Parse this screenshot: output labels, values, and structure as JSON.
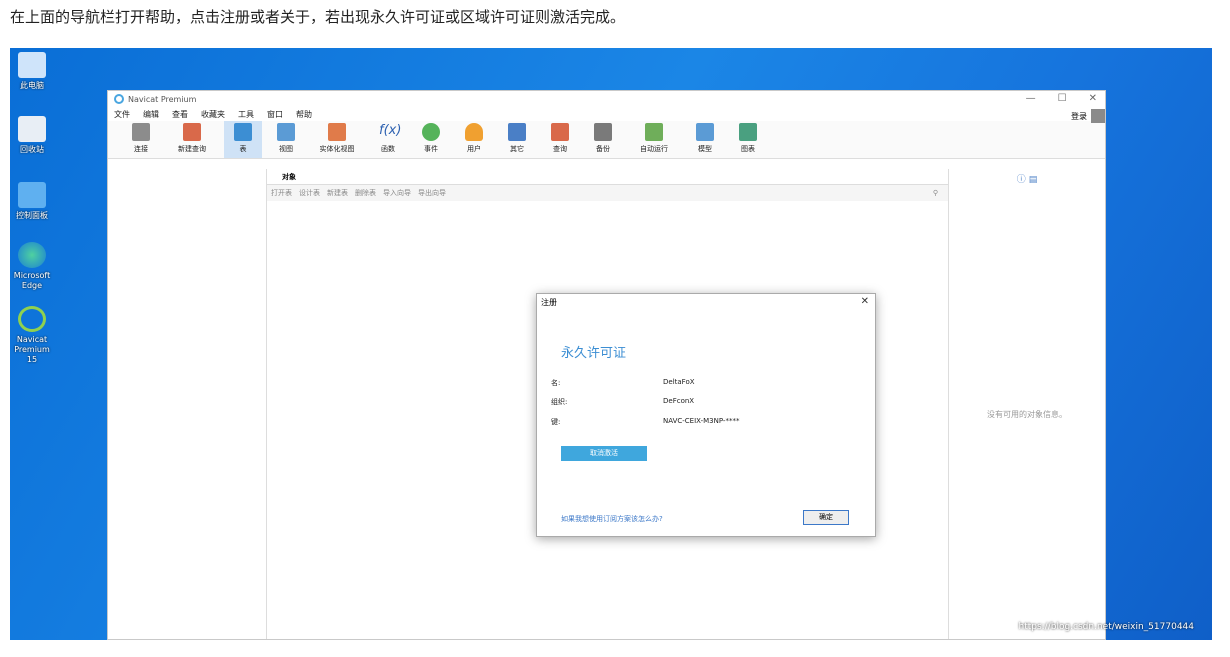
{
  "caption": "在上面的导航栏打开帮助，点击注册或者关于，若出现永久许可证或区域许可证则激活完成。",
  "desktop_icons": [
    {
      "label": "此电脑",
      "icon": "computer-icon"
    },
    {
      "label": "回收站",
      "icon": "recycle-bin-icon"
    },
    {
      "label": "控制面板",
      "icon": "control-panel-icon"
    },
    {
      "label": "Microsoft Edge",
      "icon": "edge-icon"
    },
    {
      "label": "Navicat Premium 15",
      "icon": "navicat-icon"
    }
  ],
  "window": {
    "title": "Navicat Premium",
    "controls": {
      "minimize": "—",
      "maximize": "☐",
      "close": "✕"
    },
    "login": "登录"
  },
  "menu": [
    "文件",
    "编辑",
    "查看",
    "收藏夹",
    "工具",
    "窗口",
    "帮助"
  ],
  "toolbar": [
    {
      "label": "连接",
      "icon": "connection-icon"
    },
    {
      "label": "新建查询",
      "icon": "new-query-icon"
    },
    {
      "label": "表",
      "icon": "table-icon",
      "active": true
    },
    {
      "label": "视图",
      "icon": "view-icon"
    },
    {
      "label": "实体化视图",
      "icon": "materialized-view-icon"
    },
    {
      "label": "函数",
      "icon": "function-icon"
    },
    {
      "label": "事件",
      "icon": "event-icon"
    },
    {
      "label": "用户",
      "icon": "user-icon"
    },
    {
      "label": "其它",
      "icon": "others-icon"
    },
    {
      "label": "查询",
      "icon": "query-icon"
    },
    {
      "label": "备份",
      "icon": "backup-icon"
    },
    {
      "label": "自动运行",
      "icon": "automation-icon"
    },
    {
      "label": "模型",
      "icon": "model-icon"
    },
    {
      "label": "图表",
      "icon": "chart-icon"
    }
  ],
  "object_tab": "对象",
  "object_actions": [
    "打开表",
    "设计表",
    "新建表",
    "删除表",
    "导入向导",
    "导出向导"
  ],
  "right_pane": {
    "empty_text": "没有可用的对象信息。"
  },
  "dialog": {
    "title": "注册",
    "close": "✕",
    "heading": "永久许可证",
    "rows": [
      {
        "label": "名:",
        "value": "DeltaFoX"
      },
      {
        "label": "组织:",
        "value": "DeFconX"
      },
      {
        "label": "键:",
        "value": "NAVC-CEIX-M3NP-****"
      }
    ],
    "deactivate": "取消激活",
    "help_link": "如果我想使用订阅方案该怎么办?",
    "ok": "确定"
  },
  "watermark": "https://blog.csdn.net/weixin_51770444"
}
